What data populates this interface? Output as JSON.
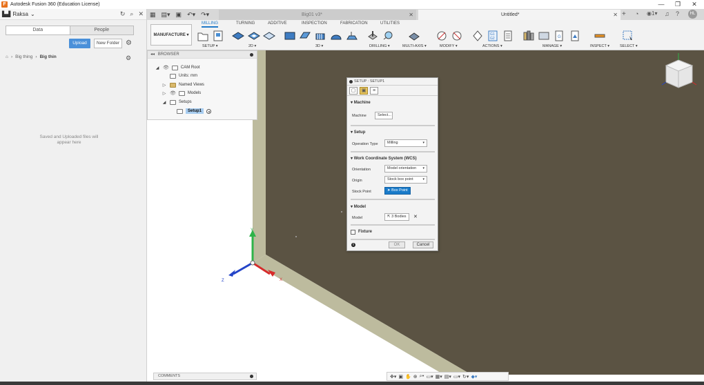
{
  "window": {
    "title": "Autodesk Fusion 360 (Education License)",
    "controls": [
      "—",
      "❐",
      "✕"
    ]
  },
  "data_panel": {
    "team": "Raksa",
    "tabs": [
      "Data",
      "People"
    ],
    "upload_label": "Upload",
    "new_folder_label": "New Folder",
    "breadcrumb": [
      "Big thing",
      "Big thin"
    ],
    "empty_message": "Saved and Uploaded files will appear here"
  },
  "tabs": {
    "inactive": "Big01 v3*",
    "active": "Untitled*",
    "user_initials": "HL",
    "job_count": "1"
  },
  "toolbar": {
    "workspace": "MANUFACTURE ▾",
    "tabs": [
      "MILLING",
      "TURNING",
      "ADDITIVE",
      "INSPECTION",
      "FABRICATION",
      "UTILITIES"
    ],
    "active_tab": "MILLING",
    "groups": [
      "SETUP ▾",
      "2D ▾",
      "3D ▾",
      "DRILLING ▾",
      "MULTI-AXIS ▾",
      "MODIFY ▾",
      "ACTIONS ▾",
      "MANAGE ▾",
      "INSPECT ▾",
      "SELECT ▾"
    ]
  },
  "browser": {
    "header": "BROWSER",
    "items": [
      {
        "label": "CAM Root"
      },
      {
        "label": "Units: mm"
      },
      {
        "label": "Named Views"
      },
      {
        "label": "Models"
      },
      {
        "label": "Setups"
      },
      {
        "label": "Setup1"
      }
    ]
  },
  "dialog": {
    "title": "SETUP : SETUP1",
    "sections": {
      "machine": "Machine",
      "setup": "Setup",
      "wcs": "Work Coordinate System (WCS)",
      "model": "Model",
      "fixture": "Fixture"
    },
    "fields": {
      "machine_label": "Machine",
      "machine_value": "Select...",
      "operation_type_label": "Operation Type",
      "operation_type_value": "Milling",
      "orientation_label": "Orientation",
      "orientation_value": "Model orientation",
      "origin_label": "Origin",
      "origin_value": "Stock box point",
      "stock_point_label": "Stock Point",
      "stock_point_value": "Box Point",
      "model_label": "Model",
      "model_value": "3 Bodies"
    },
    "ok_label": "OK",
    "cancel_label": "Cancel"
  },
  "comments": {
    "label": "COMMENTS"
  },
  "axes": {
    "y": "Y",
    "z": "Z",
    "x": "X"
  },
  "colors": {
    "accent": "#1f78c8",
    "viewport_dark": "#5b5343",
    "plane_light": "#bdbb9e",
    "axis_x": "#d62b2b",
    "axis_y": "#2fb34a",
    "axis_z": "#2444c8"
  }
}
